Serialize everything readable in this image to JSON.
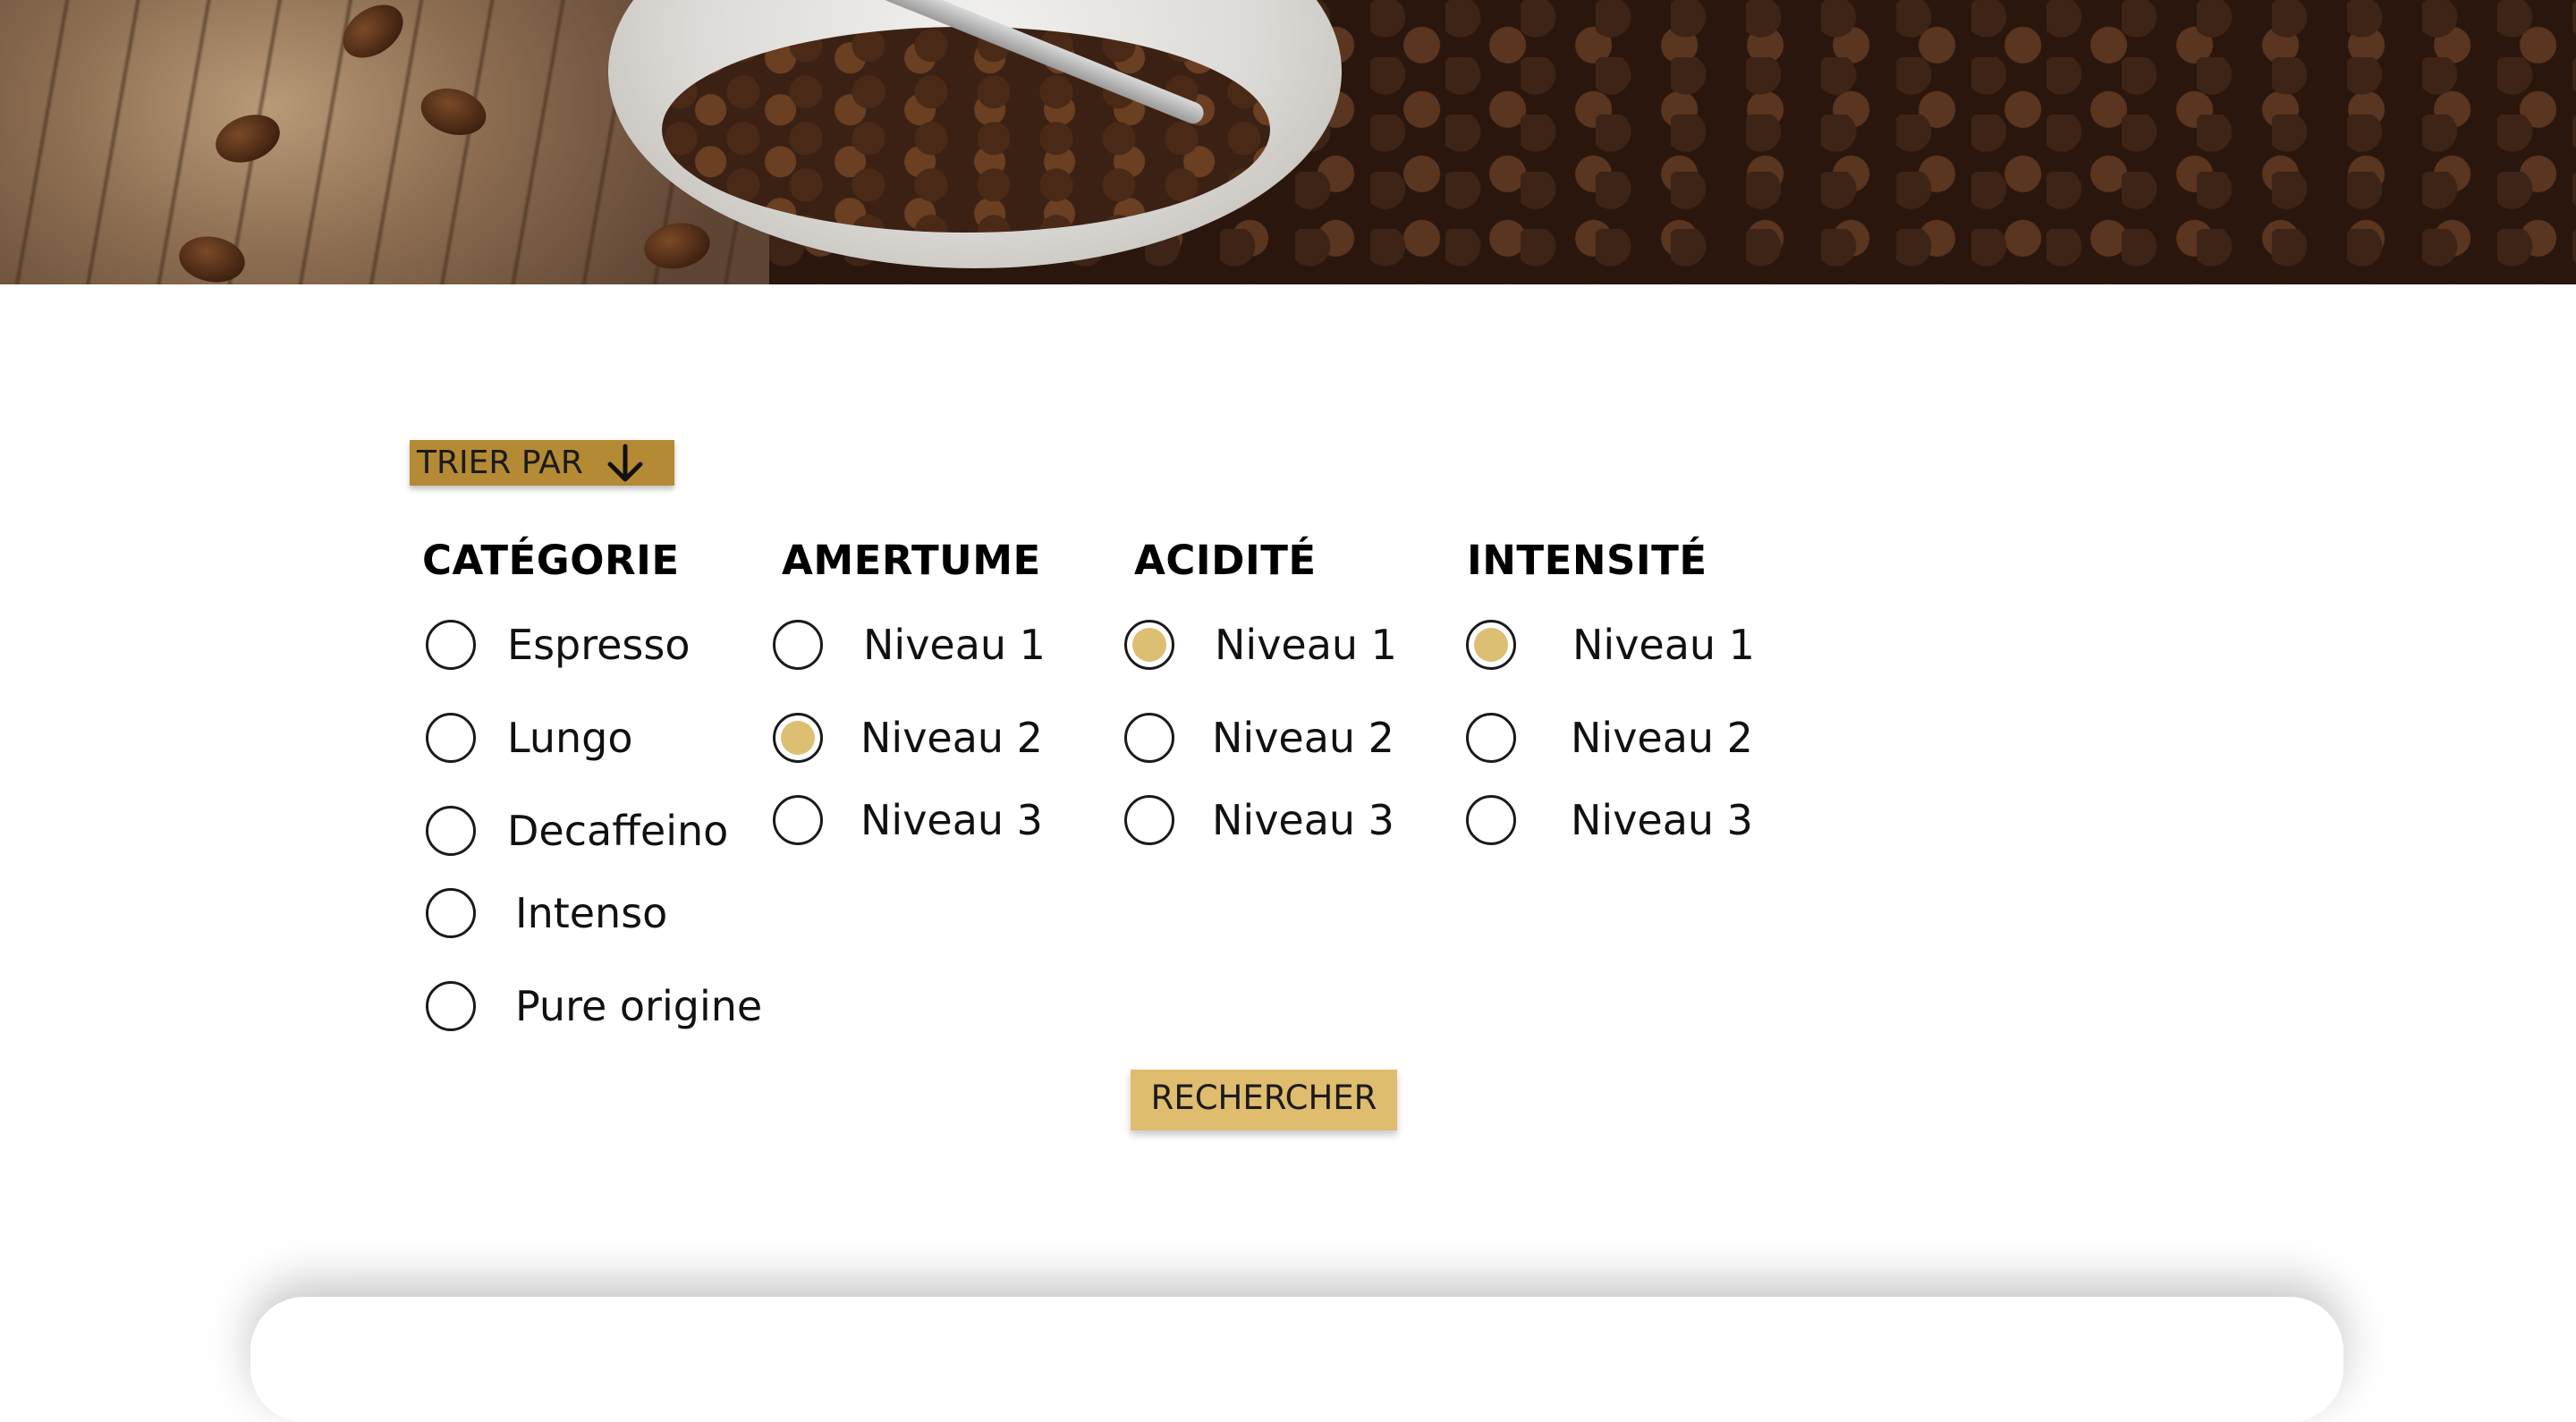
{
  "hero": {
    "image_alt": "coffee beans"
  },
  "sort": {
    "label": "TRIER PAR",
    "icon": "arrow-down-icon"
  },
  "filters": [
    {
      "title": "CATÉGORIE",
      "options": [
        {
          "label": "Espresso",
          "checked": false
        },
        {
          "label": "Lungo",
          "checked": false
        },
        {
          "label": "Decaffeino",
          "checked": false
        },
        {
          "label": "Intenso",
          "checked": false
        },
        {
          "label": "Pure origine",
          "checked": false
        }
      ]
    },
    {
      "title": "AMERTUME",
      "options": [
        {
          "label": "Niveau 1",
          "checked": false
        },
        {
          "label": "Niveau 2",
          "checked": true
        },
        {
          "label": "Niveau 3",
          "checked": false
        }
      ]
    },
    {
      "title": "ACIDITÉ",
      "options": [
        {
          "label": "Niveau 1",
          "checked": true
        },
        {
          "label": "Niveau 2",
          "checked": false
        },
        {
          "label": "Niveau 3",
          "checked": false
        }
      ]
    },
    {
      "title": "INTENSITÉ",
      "options": [
        {
          "label": "Niveau 1",
          "checked": true
        },
        {
          "label": "Niveau 2",
          "checked": false
        },
        {
          "label": "Niveau 3",
          "checked": false
        }
      ]
    }
  ],
  "search": {
    "label": "RECHERCHER"
  },
  "colors": {
    "sort_button": "#b48a34",
    "search_button": "#dfbc6e",
    "radio_checked": "#ddbf73"
  }
}
